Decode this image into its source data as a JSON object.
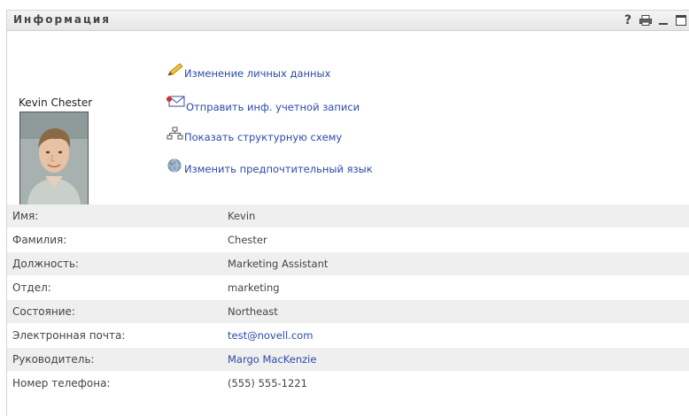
{
  "portlet": {
    "title": "Информация",
    "tools": [
      "help-icon",
      "print-icon",
      "minimize-icon",
      "maximize-icon"
    ],
    "help_glyph": "?"
  },
  "profile": {
    "name": "Kevin Chester"
  },
  "actions": [
    {
      "icon": "pencil-icon",
      "label": "Изменение личных данных"
    },
    {
      "icon": "mail-icon",
      "label": "Отправить инф. учетной записи"
    },
    {
      "icon": "org-chart-icon",
      "label": "Показать структурную схему"
    },
    {
      "icon": "globe-icon",
      "label": "Изменить предпочтительный язык"
    }
  ],
  "details": [
    {
      "label": "Имя:",
      "value": "Kevin"
    },
    {
      "label": "Фамилия:",
      "value": "Chester"
    },
    {
      "label": "Должность:",
      "value": "Marketing Assistant"
    },
    {
      "label": "Отдел:",
      "value": "marketing"
    },
    {
      "label": "Состояние:",
      "value": "Northeast"
    },
    {
      "label": "Электронная почта:",
      "value": "test@novell.com",
      "link": true
    },
    {
      "label": "Руководитель:",
      "value": "Margo MacKenzie",
      "link": true
    },
    {
      "label": "Номер телефона:",
      "value": "(555) 555-1221"
    }
  ],
  "colors": {
    "link": "#2b4aa8",
    "row_alt": "#efefef",
    "header_bg": "#e9e9e9"
  }
}
